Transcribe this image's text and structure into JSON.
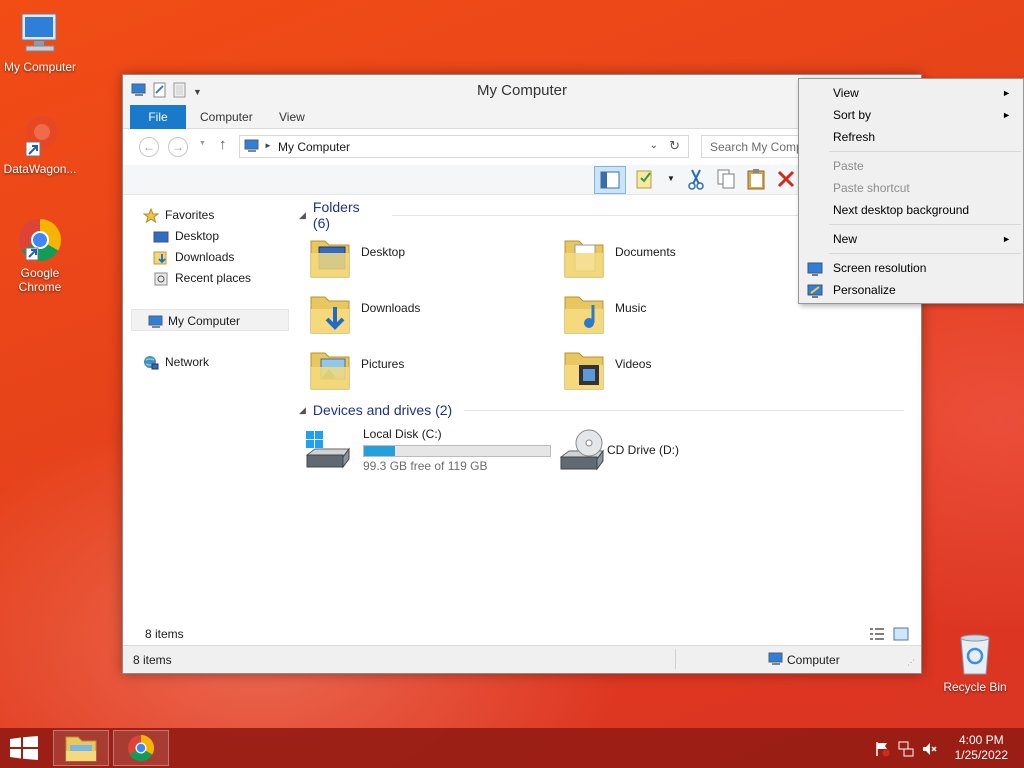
{
  "desktop": {
    "icons": [
      {
        "label": "My Computer"
      },
      {
        "label": "DataWagon..."
      },
      {
        "label": "Google Chrome"
      },
      {
        "label": "Recycle Bin"
      }
    ]
  },
  "window": {
    "title": "My Computer",
    "tabs": [
      "File",
      "Computer",
      "View"
    ],
    "address": "My Computer",
    "search_placeholder": "Search My Comp",
    "nav": {
      "favorites": "Favorites",
      "desktop": "Desktop",
      "downloads": "Downloads",
      "recent": "Recent places",
      "computer": "My Computer",
      "network": "Network"
    },
    "folders_header": "Folders (6)",
    "folders": [
      "Desktop",
      "Documents",
      "Downloads",
      "Music",
      "Pictures",
      "Videos"
    ],
    "drives_header": "Devices and drives (2)",
    "drives": [
      {
        "name": "Local Disk (C:)",
        "free": "99.3 GB free of 119 GB",
        "used_fraction": 0.166
      },
      {
        "name": "CD Drive (D:)"
      }
    ],
    "status_items_inner": "8 items",
    "status_items": "8 items",
    "status_location": "Computer"
  },
  "context_menu": {
    "items": [
      {
        "label": "View",
        "submenu": true,
        "disabled": false
      },
      {
        "label": "Sort by",
        "submenu": true,
        "disabled": false
      },
      {
        "label": "Refresh",
        "submenu": false,
        "disabled": false
      },
      {
        "label": "Paste",
        "submenu": false,
        "disabled": true
      },
      {
        "label": "Paste shortcut",
        "submenu": false,
        "disabled": true
      },
      {
        "label": "Next desktop background",
        "submenu": false,
        "disabled": false
      },
      {
        "label": "New",
        "submenu": true,
        "disabled": false
      },
      {
        "label": "Screen resolution",
        "submenu": false,
        "disabled": false
      },
      {
        "label": "Personalize",
        "submenu": false,
        "disabled": false
      }
    ]
  },
  "taskbar": {
    "time": "4:00 PM",
    "date": "1/25/2022"
  },
  "colors": {
    "accent": "#1979ca",
    "drive_bar": "#26a0da",
    "taskbar": "#961c14"
  }
}
